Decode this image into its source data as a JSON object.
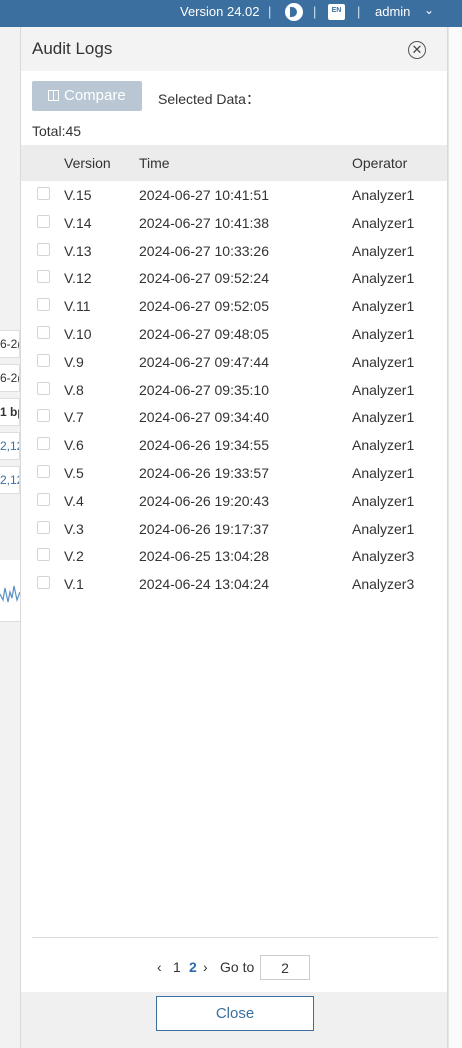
{
  "topbar": {
    "version": "Version 24.02",
    "separator": "|",
    "lang_badge": "EN",
    "user": "admin",
    "user_chevron": "⌄"
  },
  "background": {
    "fragments": [
      "6-2(",
      "6-2(",
      "1 bp",
      "2,12",
      "2,12"
    ]
  },
  "drawer": {
    "title": "Audit Logs",
    "close_icon": "✕",
    "compare_label": "Compare",
    "selected_label": "Selected Data：",
    "total_label": "Total:45",
    "columns": {
      "version": "Version",
      "time": "Time",
      "operator": "Operator"
    },
    "rows": [
      {
        "version": "V.15",
        "time": "2024-06-27 10:41:51",
        "operator": "Analyzer1"
      },
      {
        "version": "V.14",
        "time": "2024-06-27 10:41:38",
        "operator": "Analyzer1"
      },
      {
        "version": "V.13",
        "time": "2024-06-27 10:33:26",
        "operator": "Analyzer1"
      },
      {
        "version": "V.12",
        "time": "2024-06-27 09:52:24",
        "operator": "Analyzer1"
      },
      {
        "version": "V.11",
        "time": "2024-06-27 09:52:05",
        "operator": "Analyzer1"
      },
      {
        "version": "V.10",
        "time": "2024-06-27 09:48:05",
        "operator": "Analyzer1"
      },
      {
        "version": "V.9",
        "time": "2024-06-27 09:47:44",
        "operator": "Analyzer1"
      },
      {
        "version": "V.8",
        "time": "2024-06-27 09:35:10",
        "operator": "Analyzer1"
      },
      {
        "version": "V.7",
        "time": "2024-06-27 09:34:40",
        "operator": "Analyzer1"
      },
      {
        "version": "V.6",
        "time": "2024-06-26 19:34:55",
        "operator": "Analyzer1"
      },
      {
        "version": "V.5",
        "time": "2024-06-26 19:33:57",
        "operator": "Analyzer1"
      },
      {
        "version": "V.4",
        "time": "2024-06-26 19:20:43",
        "operator": "Analyzer1"
      },
      {
        "version": "V.3",
        "time": "2024-06-26 19:17:37",
        "operator": "Analyzer1"
      },
      {
        "version": "V.2",
        "time": "2024-06-25 13:04:28",
        "operator": "Analyzer3"
      },
      {
        "version": "V.1",
        "time": "2024-06-24 13:04:24",
        "operator": "Analyzer3"
      }
    ],
    "pagination": {
      "prev": "‹",
      "pages": [
        "1",
        "2"
      ],
      "current_page": "2",
      "next": "›",
      "goto_label": "Go to",
      "goto_value": "2"
    },
    "close_button": "Close"
  },
  "colors": {
    "topbar": "#3b6fa0",
    "accent": "#2d6bb0",
    "compare_disabled": "#b9c6d3"
  }
}
